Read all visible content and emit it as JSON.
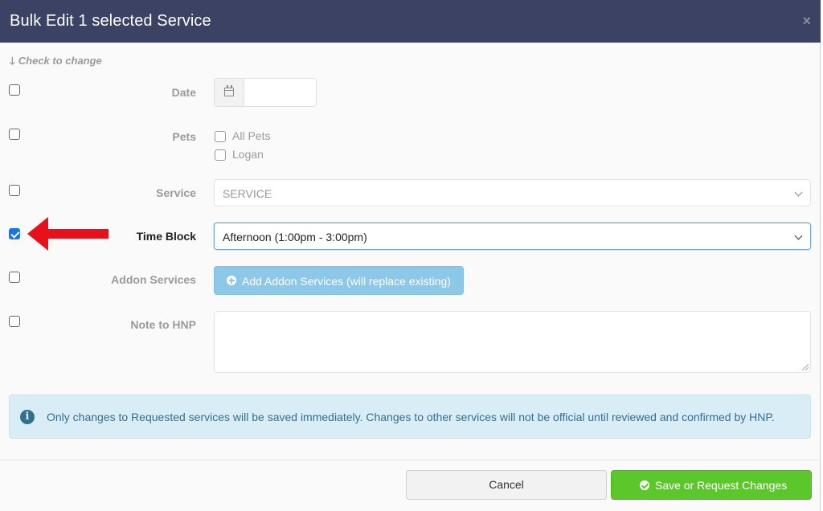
{
  "modal": {
    "title": "Bulk Edit 1 selected Service",
    "close_glyph": "×"
  },
  "hint": {
    "arrow_glyph": "🡓",
    "text": "Check to change"
  },
  "fields": {
    "date": {
      "label": "Date",
      "checked": false,
      "value": ""
    },
    "pets": {
      "label": "Pets",
      "checked": false,
      "options": [
        {
          "label": "All Pets",
          "checked": false
        },
        {
          "label": "Logan",
          "checked": false
        }
      ]
    },
    "service": {
      "label": "Service",
      "checked": false,
      "value": "SERVICE"
    },
    "time_block": {
      "label": "Time Block",
      "checked": true,
      "value": "Afternoon (1:00pm - 3:00pm)"
    },
    "addon_services": {
      "label": "Addon Services",
      "checked": false,
      "button_label": "Add Addon Services (will replace existing)"
    },
    "note": {
      "label": "Note to HNP",
      "checked": false,
      "value": ""
    }
  },
  "alert": {
    "icon": "info-icon",
    "icon_glyph": "i",
    "message": "Only changes to Requested services will be saved immediately. Changes to other services will not be official until reviewed and confirmed by HNP."
  },
  "footer": {
    "cancel_label": "Cancel",
    "save_label": "Save or Request Changes"
  },
  "colors": {
    "header_bg": "#3c4263",
    "save_green": "#5cc72a",
    "addon_blue": "#8ec8e8",
    "alert_bg": "#d9edf7",
    "arrow_red": "#e8101a"
  }
}
